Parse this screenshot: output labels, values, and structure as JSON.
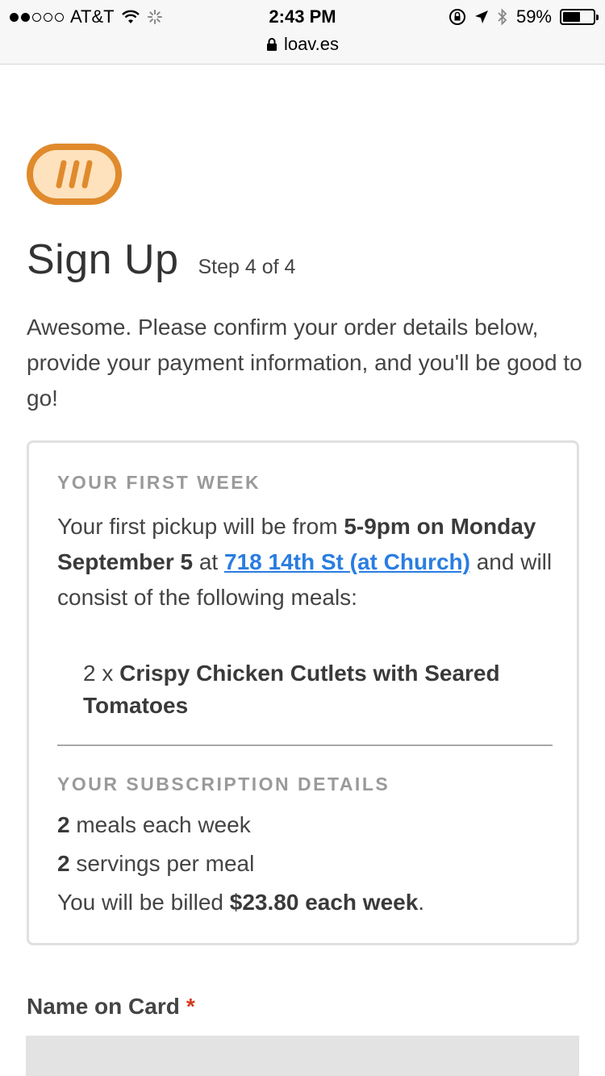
{
  "status_bar": {
    "carrier": "AT&T",
    "time": "2:43 PM",
    "battery": "59%",
    "battery_level": 0.59,
    "url": "loav.es"
  },
  "header": {
    "title": "Sign Up",
    "step": "Step 4 of 4"
  },
  "intro": "Awesome. Please confirm your order details below, provide your payment information, and you'll be good to go!",
  "first_week": {
    "heading": "YOUR FIRST WEEK",
    "text_pre": "Your first pickup will be from ",
    "time": "5-9pm on Monday September 5",
    "text_at": " at ",
    "location": "718 14th St (at Church)",
    "text_post": " and will consist of the following meals:",
    "meal_qty": "2 x ",
    "meal_name": "Crispy Chicken Cutlets with Seared Tomatoes"
  },
  "subscription": {
    "heading": "YOUR SUBSCRIPTION DETAILS",
    "meals_count": "2",
    "meals_text": " meals each week",
    "servings_count": "2",
    "servings_text": " servings per meal",
    "billing_pre": "You will be billed ",
    "billing_amount": "$23.80 each week",
    "billing_post": "."
  },
  "form": {
    "name_label": "Name on Card",
    "required_mark": "*",
    "name_value": ""
  },
  "colors": {
    "logo_orange": "#e08a2c",
    "logo_fill": "#fde2bd",
    "link": "#2a7de1",
    "required": "#d43b1c"
  }
}
